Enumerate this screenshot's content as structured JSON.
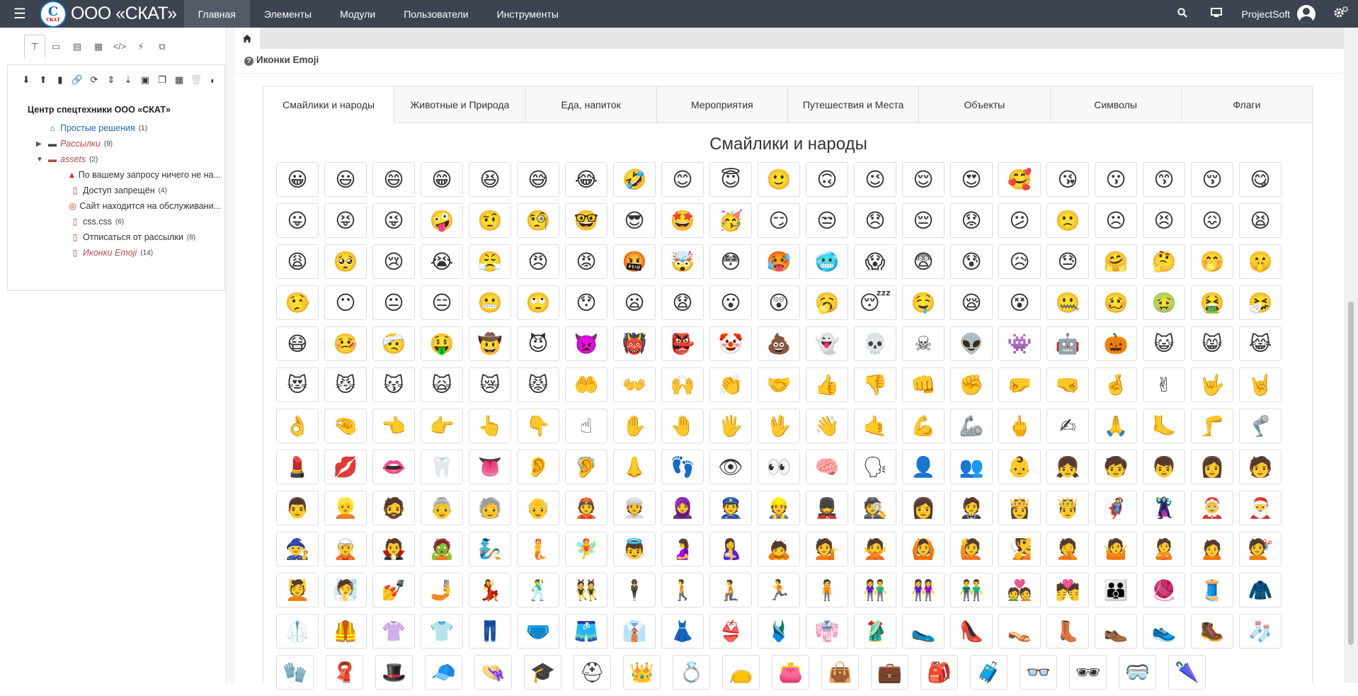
{
  "topbar": {
    "menu_icon": "hamburger-icon",
    "logo_text": "ООО «СКАТ»",
    "logo_mark": "С",
    "logo_small": "СКАТ",
    "nav": [
      "Главная",
      "Элементы",
      "Модули",
      "Пользователи",
      "Инструменты"
    ],
    "active_nav": 0,
    "user_name": "ProjectSoft",
    "icons": [
      "search-icon",
      "monitor-icon",
      "user-avatar-icon",
      "gears-icon"
    ]
  },
  "sidebar": {
    "tabs": [
      "sitemap-icon",
      "templates-icon",
      "chunks-icon",
      "modules-icon",
      "code-icon",
      "plugin-icon",
      "cubes-icon"
    ],
    "tools": [
      "arrow-down-circle-icon",
      "arrow-up-circle-icon",
      "file-icon",
      "link-icon",
      "refresh-icon",
      "sort-icon",
      "sort-amount-icon",
      "camera-icon",
      "copy-icon",
      "grid-icon",
      "trash-icon",
      "contrast-icon"
    ],
    "tree_root": "Центр спецтехники ООО «СКАТ»",
    "tree": [
      {
        "label": "Простые решения",
        "count": "(1)",
        "icon": "home-icon",
        "level": 1,
        "style": "blue",
        "toggle": ""
      },
      {
        "label": "Рассылки",
        "count": "(9)",
        "icon": "folder-icon",
        "level": 1,
        "style": "red",
        "toggle": "▶"
      },
      {
        "label": "assets",
        "count": "(2)",
        "icon": "folder-open-icon",
        "level": 1,
        "style": "red",
        "toggle": "▼"
      },
      {
        "label": "По вашему запросу ничего не на...",
        "count": "",
        "icon": "warning-icon",
        "level": 2,
        "style": "dark",
        "toggle": ""
      },
      {
        "label": "Доступ запрещён",
        "count": "(4)",
        "icon": "lock-file-icon",
        "level": 2,
        "style": "dark",
        "toggle": ""
      },
      {
        "label": "Сайт находится на обслуживани...",
        "count": "",
        "icon": "maintenance-icon",
        "level": 2,
        "style": "dark",
        "toggle": ""
      },
      {
        "label": "css.css",
        "count": "(6)",
        "icon": "file-code-icon",
        "level": 2,
        "style": "dark",
        "toggle": ""
      },
      {
        "label": "Отписаться от рассылки",
        "count": "(8)",
        "icon": "file-code-icon",
        "level": 2,
        "style": "dark",
        "toggle": ""
      },
      {
        "label": "Иконки Emoji",
        "count": "(14)",
        "icon": "file-code-icon",
        "level": 2,
        "style": "red",
        "toggle": ""
      }
    ]
  },
  "main": {
    "page_title": "Иконки Emoji",
    "home_icon": "home-icon",
    "tabs": [
      "Смайлики и народы",
      "Животные и Природа",
      "Еда, напиток",
      "Мероприятия",
      "Путешествия и Места",
      "Объекты",
      "Символы",
      "Флаги"
    ],
    "active_tab": 0,
    "section_title": "Смайлики и народы",
    "emoji_rows": [
      [
        "😀",
        "😃",
        "😄",
        "😁",
        "😆",
        "😅",
        "😂",
        "🤣",
        "😊",
        "😇",
        "🙂",
        "🙃",
        "😉",
        "😌",
        "😍",
        "🥰",
        "😘",
        "😗",
        "😙",
        "😚",
        "😋"
      ],
      [
        "😛",
        "😝",
        "😜",
        "🤪",
        "🤨",
        "🧐",
        "🤓",
        "😎",
        "🤩",
        "🥳",
        "😏",
        "😒",
        "😞",
        "😔",
        "😟",
        "😕",
        "🙁",
        "☹",
        "😣",
        "😖",
        "😫"
      ],
      [
        "😩",
        "🥺",
        "😢",
        "😭",
        "😤",
        "😠",
        "😡",
        "🤬",
        "🤯",
        "😳",
        "🥵",
        "🥶",
        "😱",
        "😨",
        "😰",
        "😥",
        "😓",
        "🤗",
        "🤔",
        "🤭",
        "🤫"
      ],
      [
        "🤥",
        "😶",
        "😐",
        "😑",
        "😬",
        "🙄",
        "😯",
        "😦",
        "😧",
        "😮",
        "😲",
        "🥱",
        "😴",
        "🤤",
        "😪",
        "😵",
        "🤐",
        "🥴",
        "🤢",
        "🤮",
        "🤧"
      ],
      [
        "😷",
        "🤒",
        "🤕",
        "🤑",
        "🤠",
        "😈",
        "👿",
        "👹",
        "👺",
        "🤡",
        "💩",
        "👻",
        "💀",
        "☠",
        "👽",
        "👾",
        "🤖",
        "🎃",
        "😺",
        "😸",
        "😹"
      ],
      [
        "😻",
        "😼",
        "😽",
        "🙀",
        "😿",
        "😾",
        "🤲",
        "👐",
        "🙌",
        "👏",
        "🤝",
        "👍",
        "👎",
        "👊",
        "✊",
        "🤛",
        "🤜",
        "🤞",
        "✌",
        "🤟",
        "🤘"
      ],
      [
        "👌",
        "🤏",
        "👈",
        "👉",
        "👆",
        "👇",
        "☝",
        "✋",
        "🤚",
        "🖐",
        "🖖",
        "👋",
        "🤙",
        "💪",
        "🦾",
        "🖕",
        "✍",
        "🙏",
        "🦶",
        "🦵",
        "🦿"
      ],
      [
        "💄",
        "💋",
        "👄",
        "🦷",
        "👅",
        "👂",
        "🦻",
        "👃",
        "👣",
        "👁",
        "👀",
        "🧠",
        "🗣",
        "👤",
        "👥",
        "👶",
        "👧",
        "🧒",
        "👦",
        "👩",
        "🧑"
      ],
      [
        "👨",
        "👱",
        "🧔",
        "👵",
        "🧓",
        "👴",
        "👲",
        "👳",
        "🧕",
        "👮",
        "👷",
        "💂",
        "🕵",
        "👩",
        "🤵",
        "👸",
        "🤴",
        "🦸",
        "🦹",
        "🤶",
        "🎅"
      ],
      [
        "🧙",
        "🧝",
        "🧛",
        "🧟",
        "🧞",
        "🧜",
        "🧚",
        "👼",
        "🤰",
        "🤱",
        "🙇",
        "💁",
        "🙅",
        "🙆",
        "🙋",
        "🧏",
        "🤦",
        "🤷",
        "🙎",
        "🙍",
        "💇"
      ],
      [
        "💆",
        "🧖",
        "💅",
        "🤳",
        "💃",
        "🕺",
        "👯",
        "🕴",
        "🚶",
        "🧎",
        "🏃",
        "🧍",
        "👫",
        "👭",
        "👬",
        "💑",
        "💏",
        "👪",
        "🧶",
        "🧵",
        "🧥"
      ],
      [
        "🥼",
        "🦺",
        "👚",
        "👕",
        "👖",
        "🩲",
        "🩳",
        "👔",
        "👗",
        "👙",
        "🩱",
        "👘",
        "🥻",
        "🥿",
        "👠",
        "👡",
        "👢",
        "👞",
        "👟",
        "🥾",
        "🧦"
      ],
      [
        "🧤",
        "🧣",
        "🎩",
        "🧢",
        "👒",
        "🎓",
        "⛑",
        "👑",
        "💍",
        "👝",
        "👛",
        "👜",
        "💼",
        "🎒",
        "🧳",
        "👓",
        "🕶",
        "🥽",
        "🌂"
      ]
    ]
  }
}
